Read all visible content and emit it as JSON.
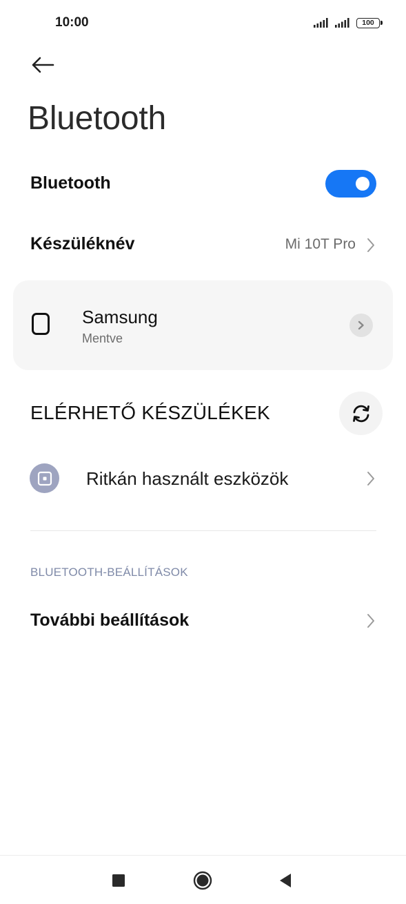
{
  "status_bar": {
    "time": "10:00",
    "battery": "100",
    "icons": [
      "signal-icon",
      "signal-icon",
      "battery-icon"
    ]
  },
  "header": {
    "back_icon": "arrow-left-icon",
    "title": "Bluetooth"
  },
  "bluetooth_toggle": {
    "label": "Bluetooth",
    "enabled": true,
    "accent_color": "#1677f5"
  },
  "device_name": {
    "label": "Készüléknév",
    "value": "Mi 10T Pro"
  },
  "paired_devices": [
    {
      "name": "Samsung",
      "status": "Mentve",
      "icon": "phone-outline-icon"
    }
  ],
  "available_devices": {
    "header": "ELÉRHETŐ KÉSZÜLÉKEK",
    "refresh_icon": "refresh-icon",
    "items": [
      {
        "label": "Ritkán használt eszközök",
        "icon": "device-square-icon"
      }
    ]
  },
  "bluetooth_settings": {
    "header": "BLUETOOTH-BEÁLLÍTÁSOK",
    "more_settings_label": "További beállítások"
  },
  "nav_bar": {
    "buttons": [
      "recents-square-icon",
      "home-circle-icon",
      "back-triangle-icon"
    ]
  }
}
